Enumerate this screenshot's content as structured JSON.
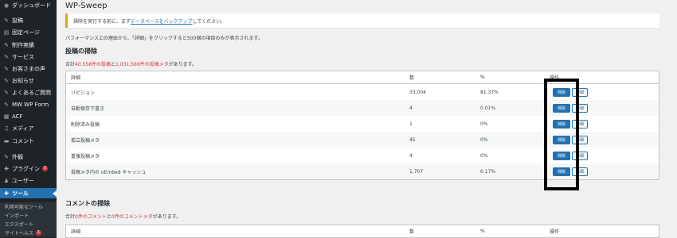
{
  "sidebar": {
    "items": [
      {
        "icon": "dashboard-icon",
        "glyph": "◉",
        "label": "ダッシュボード"
      },
      {
        "icon": "pin-icon",
        "glyph": "✎",
        "label": "投稿"
      },
      {
        "icon": "page-icon",
        "glyph": "▤",
        "label": "固定ページ"
      },
      {
        "icon": "pin-icon",
        "glyph": "✎",
        "label": "制作実績"
      },
      {
        "icon": "pin-icon",
        "glyph": "✎",
        "label": "サービス"
      },
      {
        "icon": "pin-icon",
        "glyph": "✎",
        "label": "お客さまの声"
      },
      {
        "icon": "pin-icon",
        "glyph": "✎",
        "label": "お知らせ"
      },
      {
        "icon": "pin-icon",
        "glyph": "✎",
        "label": "よくあるご質問"
      },
      {
        "icon": "pin-icon",
        "glyph": "✎",
        "label": "MW WP Form"
      },
      {
        "icon": "acf-icon",
        "glyph": "▦",
        "label": "ACF"
      },
      {
        "icon": "media-icon",
        "glyph": "♫",
        "label": "メディア"
      },
      {
        "icon": "comment-icon",
        "glyph": "▬",
        "label": "コメント"
      },
      {
        "icon": "appearance-icon",
        "glyph": "✎",
        "label": "外観"
      },
      {
        "icon": "plugin-icon",
        "glyph": "✚",
        "label": "プラグイン",
        "badge": "3"
      },
      {
        "icon": "user-icon",
        "glyph": "♟",
        "label": "ユーザー"
      },
      {
        "icon": "tool-icon",
        "glyph": "✚",
        "label": "ツール"
      }
    ],
    "submenu": [
      {
        "label": "利用可能なツール"
      },
      {
        "label": "インポート"
      },
      {
        "label": "エクスポート"
      },
      {
        "label": "サイトヘルス",
        "badge": "1"
      }
    ]
  },
  "page": {
    "title": "WP-Sweep",
    "notice_before": "掃除を実行する前に、まず",
    "notice_link": "データベースをバックアップ",
    "notice_after": "してください。",
    "info": "パフォーマンス上の理由から、「詳細」をクリックすると500個の項目のみが表示されます。"
  },
  "posts_section": {
    "title": "投稿の掃除",
    "summary_prefix": "合計",
    "summary_posts": "40,558件の投稿",
    "summary_and": "と",
    "summary_meta": "1,031,566件の投稿メタ",
    "summary_suffix": "があります。",
    "headers": {
      "details": "詳細",
      "count": "数",
      "percent": "%",
      "action": "操作"
    },
    "rows": [
      {
        "details": "リビジョン",
        "count": "33,004",
        "percent": "81.37%"
      },
      {
        "details": "自動保存下書き",
        "count": "4",
        "percent": "0.01%"
      },
      {
        "details": "削除済み投稿",
        "count": "1",
        "percent": "0%"
      },
      {
        "details": "孤立投稿メタ",
        "count": "45",
        "percent": "0%"
      },
      {
        "details": "重複投稿メタ",
        "count": "4",
        "percent": "0%"
      },
      {
        "details": "投稿メタ内の oEmbed キャッシュ",
        "count": "1,707",
        "percent": "0.17%"
      }
    ],
    "sweep_label": "掃除",
    "details_label": "詳細"
  },
  "comments_section": {
    "title": "コメントの掃除",
    "summary_prefix": "合計",
    "summary_comments": "0件のコメント",
    "summary_and": "と",
    "summary_meta": "0件のコメントメタ",
    "summary_suffix": "があります。",
    "headers": {
      "details": "詳細",
      "count": "数",
      "percent": "%",
      "action": "操作"
    }
  }
}
